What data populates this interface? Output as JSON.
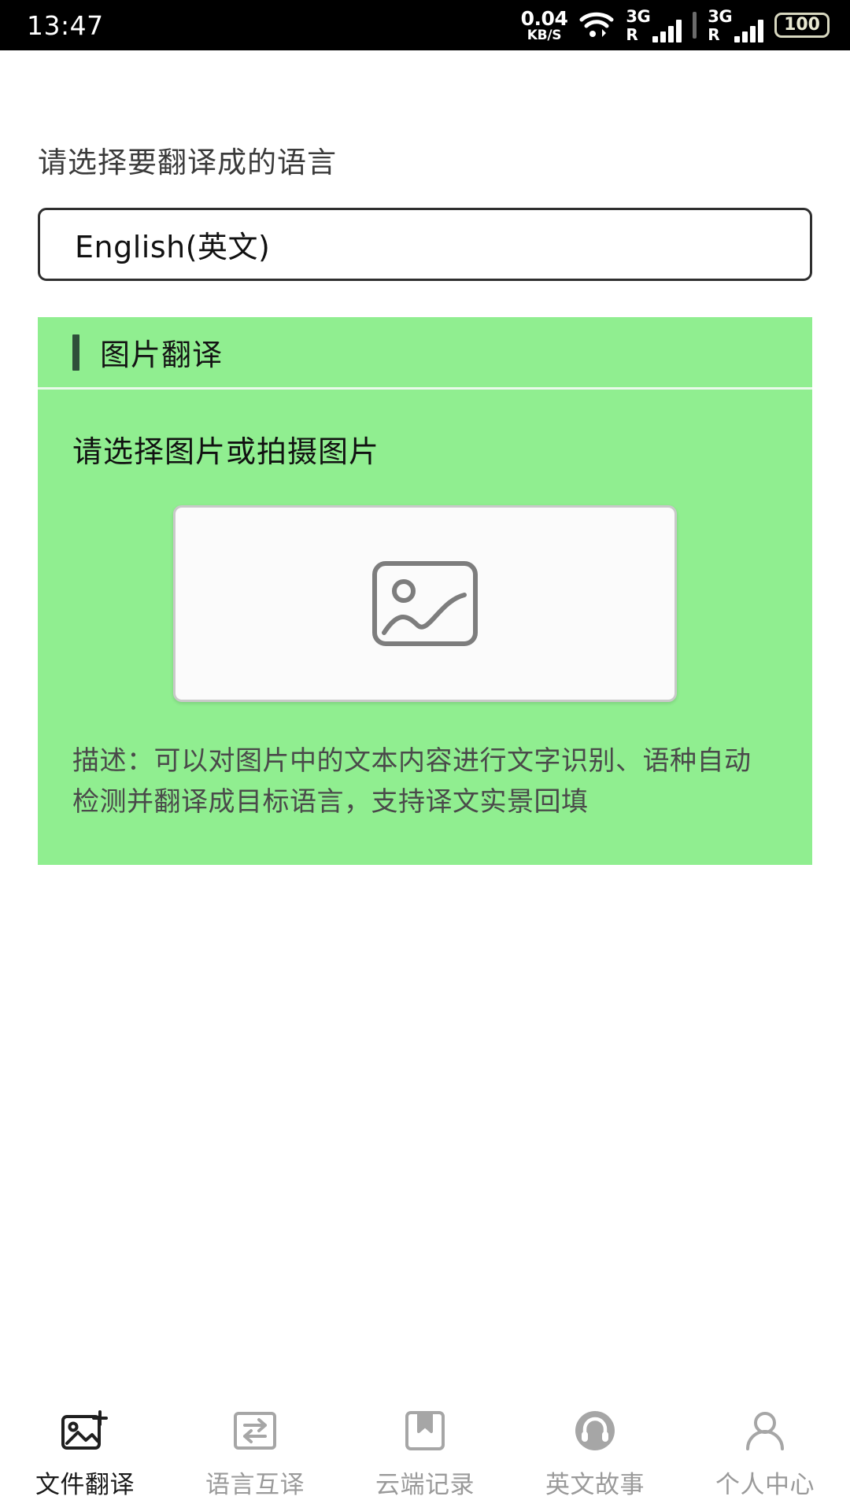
{
  "status_bar": {
    "time": "13:47",
    "net_speed_value": "0.04",
    "net_speed_unit": "KB/S",
    "sim1_label": "3G",
    "sim1_roaming": "R",
    "sim2_label": "3G",
    "sim2_roaming": "R",
    "battery": "100"
  },
  "selector": {
    "label": "请选择要翻译成的语言",
    "value": "English(英文)"
  },
  "card": {
    "title": "图片翻译",
    "subtitle": "请选择图片或拍摄图片",
    "description": "描述：可以对图片中的文本内容进行文字识别、语种自动检测并翻译成目标语言，支持译文实景回填",
    "accent_color": "#2f4f3a",
    "background_color": "#90ee90"
  },
  "tabbar": {
    "items": [
      {
        "label": "文件翻译",
        "icon": "image-add-icon",
        "active": true
      },
      {
        "label": "语言互译",
        "icon": "swap-arrows-icon",
        "active": false
      },
      {
        "label": "云端记录",
        "icon": "bookmark-icon",
        "active": false
      },
      {
        "label": "英文故事",
        "icon": "headphones-icon",
        "active": false
      },
      {
        "label": "个人中心",
        "icon": "person-icon",
        "active": false
      }
    ]
  }
}
